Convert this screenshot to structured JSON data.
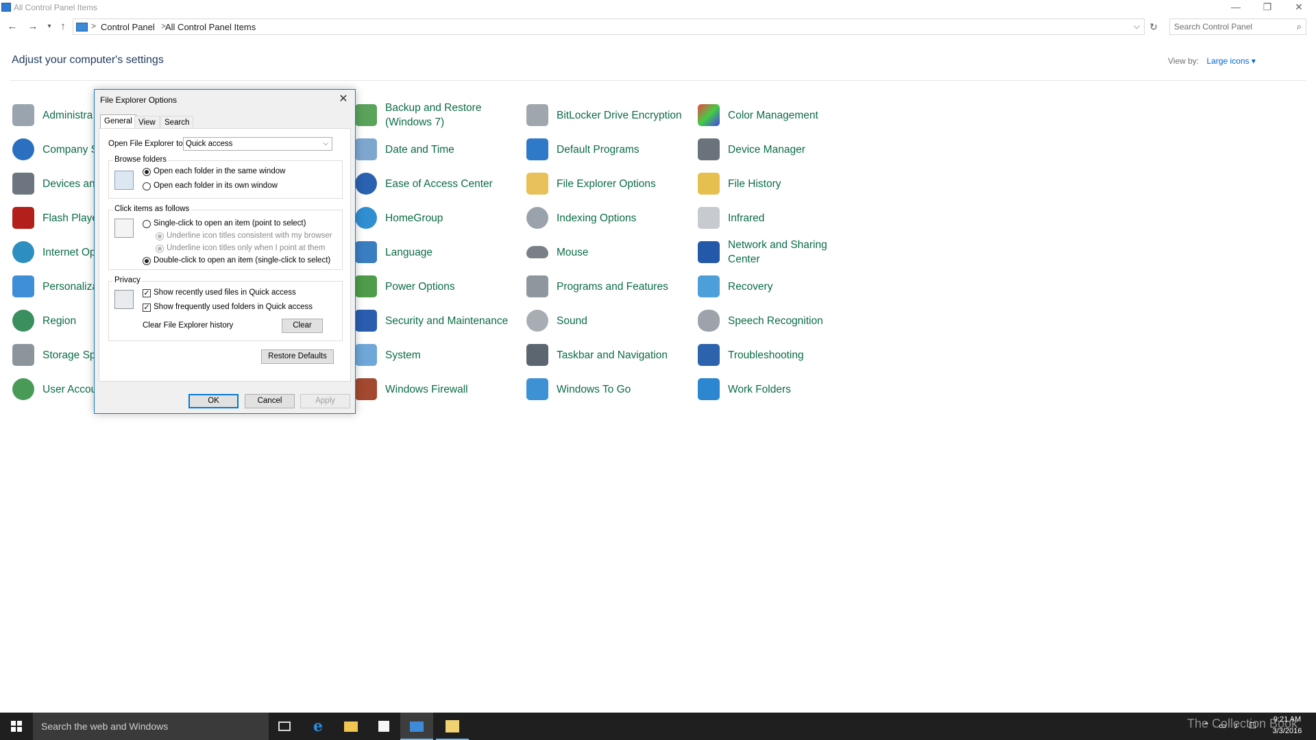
{
  "window": {
    "title": "All Control Panel Items",
    "minimize_glyph": "—",
    "restore_glyph": "❐",
    "close_glyph": "✕"
  },
  "address": {
    "breadcrumb": [
      "Control Panel",
      "All Control Panel Items"
    ],
    "separator": ">",
    "search_placeholder": "Search Control Panel"
  },
  "header": {
    "title": "Adjust your computer's settings",
    "view_by_label": "View by:",
    "view_by_value": "Large icons ▾"
  },
  "items": {
    "col1": [
      "Administra",
      "Company S",
      "Devices an",
      "Flash Playe",
      "Internet Op",
      "Personaliza",
      "Region",
      "Storage Sp",
      "User Accou"
    ],
    "col2": [
      "Backup and Restore (Windows 7)",
      "Date and Time",
      "Ease of Access Center",
      "HomeGroup",
      "Language",
      "Power Options",
      "Security and Maintenance",
      "System",
      "Windows Firewall"
    ],
    "col3": [
      "BitLocker Drive Encryption",
      "Default Programs",
      "File Explorer Options",
      "Indexing Options",
      "Mouse",
      "Programs and Features",
      "Sound",
      "Taskbar and Navigation",
      "Windows To Go"
    ],
    "col4": [
      "Color Management",
      "Device Manager",
      "File History",
      "Infrared",
      "Network and Sharing Center",
      "Recovery",
      "Speech Recognition",
      "Troubleshooting",
      "Work Folders"
    ]
  },
  "dialog": {
    "title": "File Explorer Options",
    "close_glyph": "✕",
    "tabs": [
      "General",
      "View",
      "Search"
    ],
    "open_to_label": "Open File Explorer to:",
    "open_to_value": "Quick access",
    "browse_group": "Browse folders",
    "browse_same": "Open each folder in the same window",
    "browse_own": "Open each folder in its own window",
    "click_group": "Click items as follows",
    "single_click": "Single-click to open an item (point to select)",
    "underline_browser": "Underline icon titles consistent with my browser",
    "underline_point": "Underline icon titles only when I point at them",
    "double_click": "Double-click to open an item (single-click to select)",
    "privacy_group": "Privacy",
    "recent_files": "Show recently used files in Quick access",
    "frequent_folders": "Show frequently used folders in Quick access",
    "clear_history_label": "Clear File Explorer history",
    "clear_button": "Clear",
    "restore_defaults": "Restore Defaults",
    "ok": "OK",
    "cancel": "Cancel",
    "apply": "Apply"
  },
  "taskbar": {
    "search_placeholder": "Search the web and Windows",
    "watermark": "The Collection Book",
    "time": "9:21 AM",
    "date": "3/3/2016"
  },
  "colors": {
    "link_green": "#0b6c45",
    "heading_blue": "#1e395b",
    "accent": "#0078d7"
  }
}
